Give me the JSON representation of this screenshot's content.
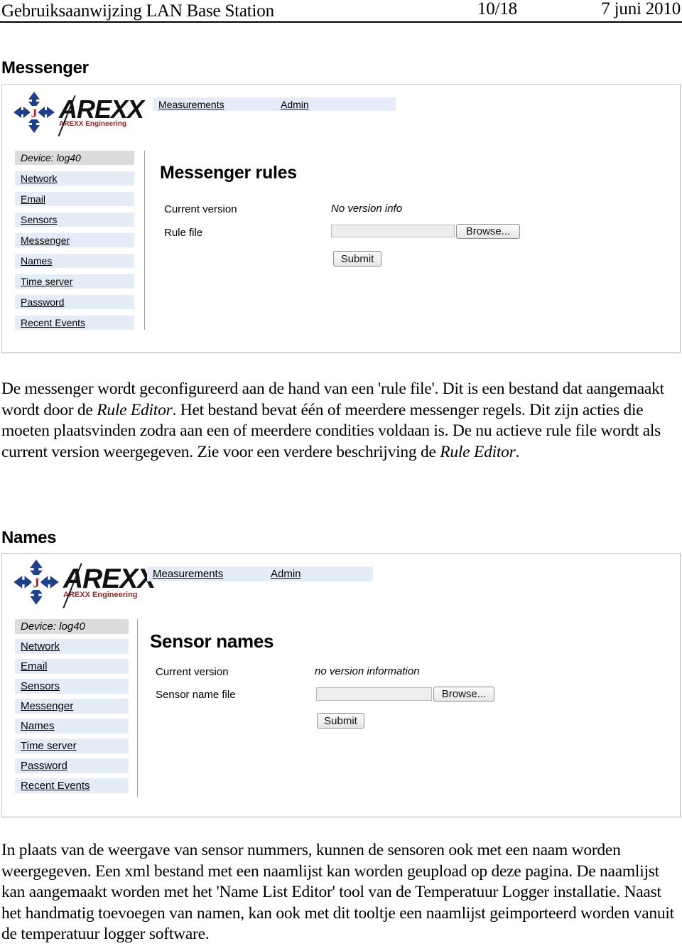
{
  "header": {
    "title": "Gebruiksaanwijzing LAN Base Station",
    "page_number": "10/18",
    "date": "7 juni 2010"
  },
  "sections": [
    {
      "heading": "Messenger",
      "screenshot": {
        "logo": {
          "word": "AREXX",
          "subtitle": "AREXX Engineering"
        },
        "nav_tabs": [
          {
            "label": "Measurements"
          },
          {
            "label": "Admin"
          }
        ],
        "sidebar": [
          {
            "label": "Device: log40",
            "type": "device"
          },
          {
            "label": "Network",
            "type": "link"
          },
          {
            "label": "Email",
            "type": "link"
          },
          {
            "label": "Sensors",
            "type": "link"
          },
          {
            "label": "Messenger",
            "type": "link"
          },
          {
            "label": "Names",
            "type": "link"
          },
          {
            "label": "Time server",
            "type": "link"
          },
          {
            "label": "Password",
            "type": "link"
          },
          {
            "label": "Recent Events",
            "type": "link"
          }
        ],
        "pane": {
          "title": "Messenger rules",
          "current_version_label": "Current version",
          "current_version_value": "No version info",
          "file_label": "Rule file",
          "file_input_value": "",
          "browse_label": "Browse...",
          "submit_label": "Submit"
        }
      },
      "paragraph_html": "De messenger wordt geconfigureerd aan de hand van een 'rule file'. Dit is een bestand dat aangemaakt wordt door de <i>Rule Editor</i>. Het bestand bevat één of meerdere messenger regels. Dit zijn acties die moeten plaatsvinden zodra aan een of meerdere condities voldaan is. De nu actieve rule file wordt als current version weergegeven. Zie voor een verdere beschrijving de <i>Rule Editor</i>."
    },
    {
      "heading": "Names",
      "screenshot": {
        "logo": {
          "word": "AREXX",
          "subtitle": "AREXX Engineering"
        },
        "nav_tabs": [
          {
            "label": "Measurements"
          },
          {
            "label": "Admin"
          }
        ],
        "sidebar": [
          {
            "label": "Device: log40",
            "type": "device"
          },
          {
            "label": "Network",
            "type": "link"
          },
          {
            "label": "Email",
            "type": "link"
          },
          {
            "label": "Sensors",
            "type": "link"
          },
          {
            "label": "Messenger",
            "type": "link"
          },
          {
            "label": "Names",
            "type": "link"
          },
          {
            "label": "Time server",
            "type": "link"
          },
          {
            "label": "Password",
            "type": "link"
          },
          {
            "label": "Recent Events",
            "type": "link"
          }
        ],
        "pane": {
          "title": "Sensor names",
          "current_version_label": "Current version",
          "current_version_value": "no version information",
          "file_label": "Sensor name file",
          "file_input_value": "",
          "browse_label": "Browse...",
          "submit_label": "Submit"
        }
      },
      "paragraph_html": "In plaats van de weergave van sensor nummers, kunnen de sensoren ook met een naam worden weergegeven. Een xml bestand met een naamlijst kan worden geupload op deze pagina. De naamlijst kan aangemaakt worden met het 'Name List Editor' tool van de Temperatuur Logger installatie. Naast het handmatig toevoegen van namen, kan ook met dit tooltje een naamlijst geimporteerd worden vanuit de temperatuur logger software."
    }
  ],
  "colors": {
    "nav_tab_bg": "#e3ecf7",
    "device_row_bg": "#dcdcdc",
    "logo_blue": "#1f3f87",
    "logo_red": "#b01c1c",
    "logo_sub_red": "#8a2b2b"
  }
}
